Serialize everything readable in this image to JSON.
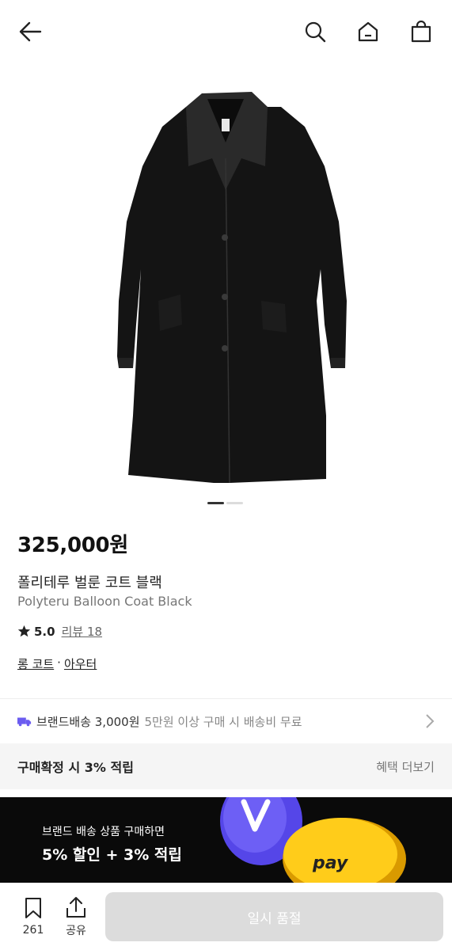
{
  "header": {
    "back_icon": "arrow-left-icon",
    "search_icon": "search-icon",
    "home_icon": "home-icon",
    "bag_icon": "shopping-bag-icon"
  },
  "product": {
    "price": "325,000원",
    "name_ko": "폴리테루 벌룬 코트 블랙",
    "name_en": "Polyteru Balloon Coat Black",
    "rating": "5.0",
    "review_label": "리뷰 18",
    "category_1": "롱 코트",
    "category_sep": "·",
    "category_2": "아우터",
    "image_index": 1,
    "image_count": 2
  },
  "shipping": {
    "label": "브랜드배송 3,000원",
    "sub": "5만원 이상 구매 시 배송비 무료"
  },
  "points": {
    "left": "구매확정 시 3% 적립",
    "right": "혜택 더보기"
  },
  "banner": {
    "line1": "브랜드 배송 상품 구매하면",
    "line2": "5% 할인 + 3% 적립",
    "coin_text": "pay"
  },
  "bottom_bar": {
    "bookmark_count": "261",
    "share_label": "공유",
    "buy_label": "일시 품절"
  },
  "colors": {
    "buy_disabled": "#dcdcdc",
    "banner_bg": "#0a0a0a",
    "truck": "#6b5cf0"
  }
}
